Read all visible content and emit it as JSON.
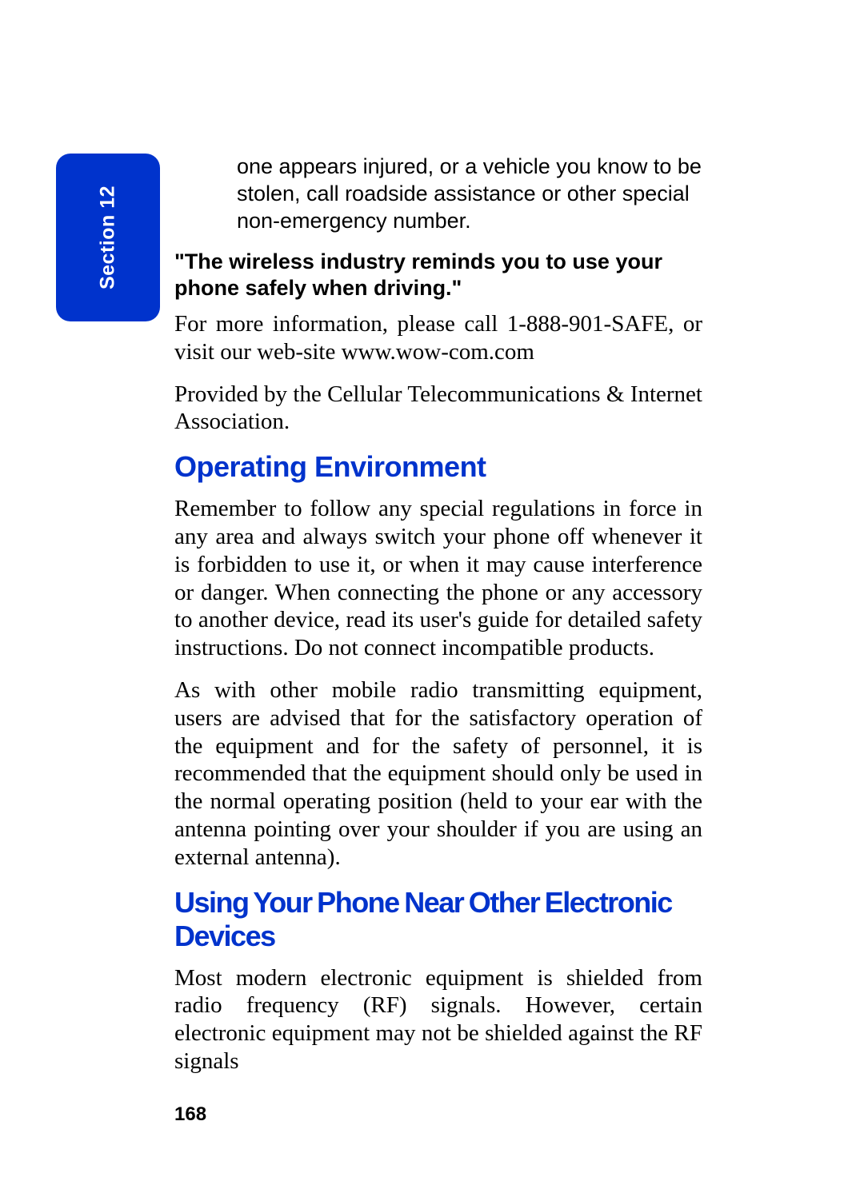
{
  "section_tab": {
    "label": "Section 12"
  },
  "content": {
    "intro": "one appears injured, or a vehicle you know to be stolen, call roadside assistance or other special non-emergency number.",
    "bold_quote": "\"The wireless industry reminds you to use your phone safely when driving.\"",
    "para1": "For more information, please call 1-888-901-SAFE, or visit our web-site www.wow-com.com",
    "para2": "Provided by the Cellular Telecommunications & Internet Association.",
    "heading1": "Operating Environment",
    "para3": "Remember to follow any special regulations in force in any area and always switch your phone off whenever it is forbidden to use it, or when it may cause interference or danger. When connecting the phone or any accessory to another device, read its user's guide for detailed safety instructions. Do not connect incompatible products.",
    "para4": "As with other mobile radio transmitting equipment, users are advised that for the satisfactory operation of the equipment and for the safety of personnel, it is recommended that the equipment should only be used in the normal operating position (held to your ear with the antenna pointing over your shoulder if you are using an external antenna).",
    "heading2": "Using Your Phone Near Other Electronic Devices",
    "para5": "Most modern electronic equipment is shielded from radio frequency (RF) signals. However, certain electronic equipment may not be shielded against the RF signals"
  },
  "page_number": "168"
}
